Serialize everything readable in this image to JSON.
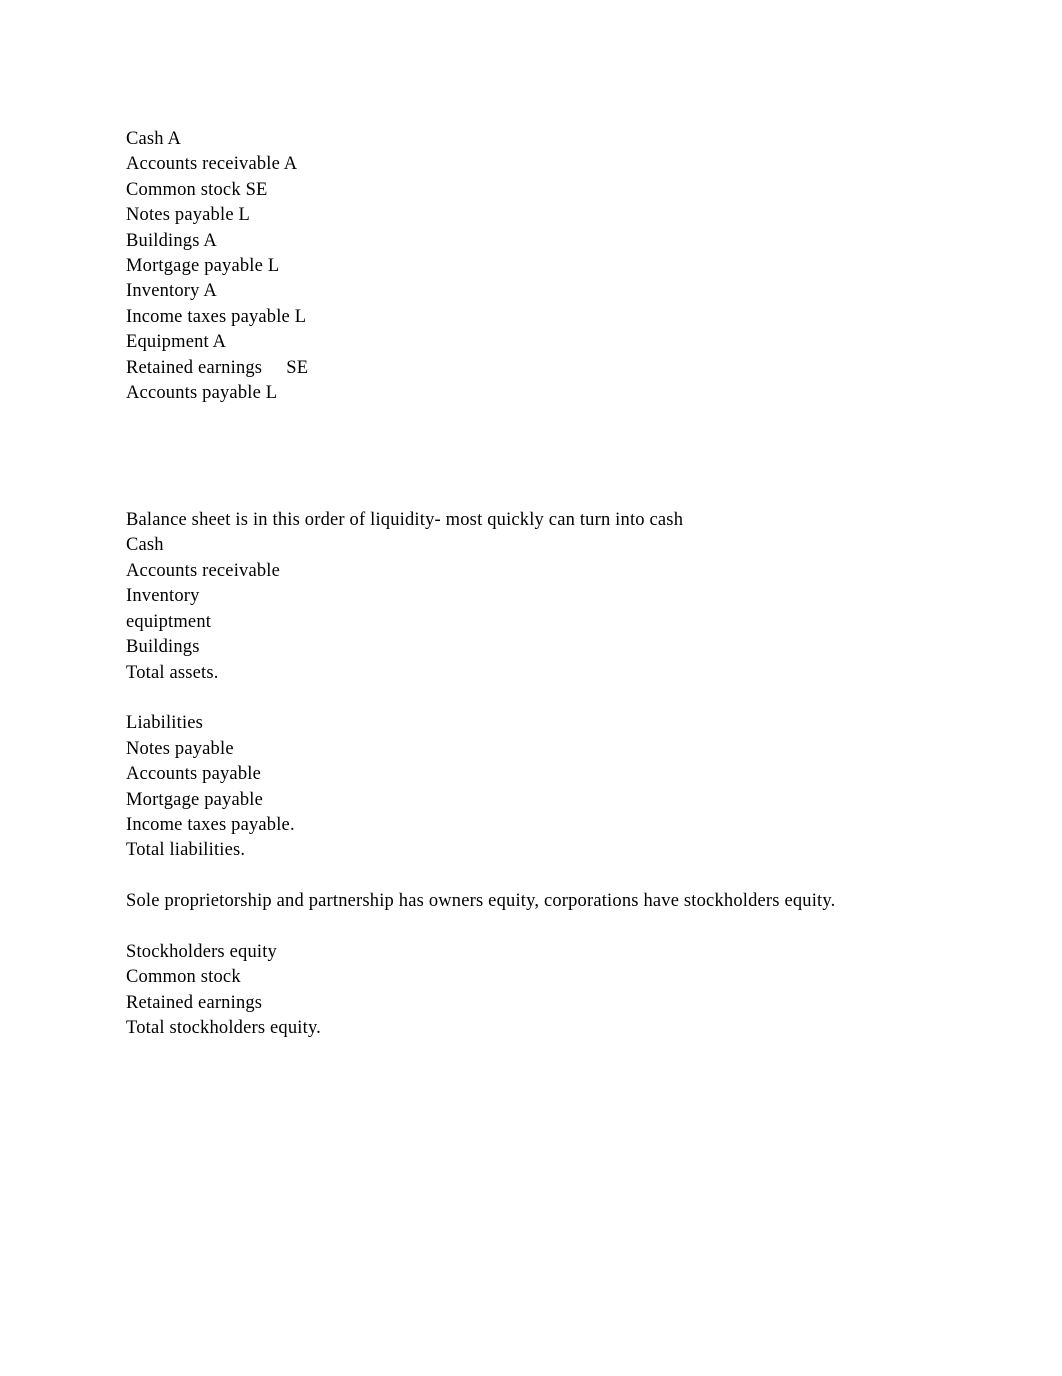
{
  "document": {
    "page_background": "#ffffff",
    "text_color": "#000000",
    "blocks": [
      {
        "id": "account-classification-list",
        "lines": [
          "Cash A",
          "Accounts receivable A",
          "Common stock SE",
          "Notes payable L",
          "Buildings A",
          "Mortgage payable L",
          "Inventory A",
          "Income taxes payable L",
          "Equipment A",
          "Retained earnings     SE",
          "Accounts payable L"
        ]
      },
      {
        "id": "assets-liquidity-order",
        "lines": [
          "Balance sheet is in this order of liquidity- most quickly can turn into cash",
          "Cash",
          "Accounts receivable",
          "Inventory",
          "equiptment",
          "Buildings",
          "Total assets."
        ]
      },
      {
        "id": "liabilities-list",
        "lines": [
          "Liabilities",
          "Notes payable",
          "Accounts payable",
          "Mortgage payable",
          "Income taxes payable.",
          "Total liabilities."
        ]
      },
      {
        "id": "equity-note",
        "lines": [
          "Sole proprietorship and partnership has owners equity, corporations have stockholders equity."
        ]
      },
      {
        "id": "stockholders-equity-list",
        "lines": [
          "Stockholders equity",
          "Common stock",
          "Retained earnings",
          "Total stockholders equity."
        ]
      }
    ]
  }
}
